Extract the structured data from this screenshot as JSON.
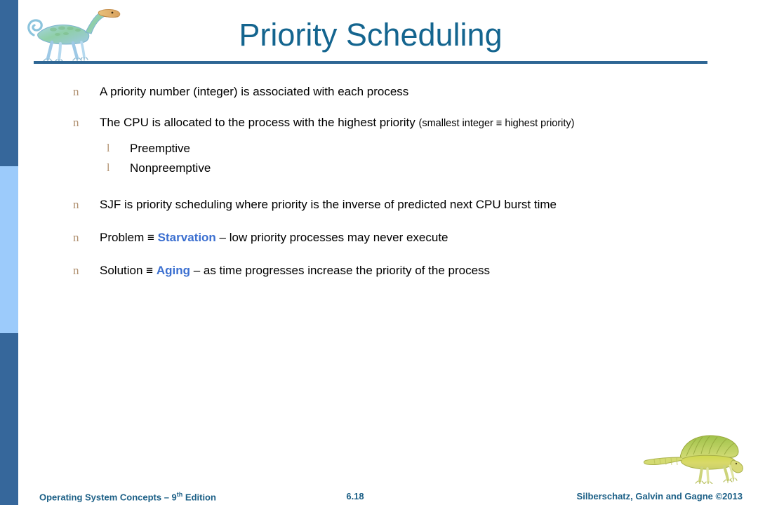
{
  "slide": {
    "title": "Priority Scheduling",
    "accent_color": "#14658f",
    "rule_color": "#2e6694",
    "bullet_marker_color": "#b09070",
    "keyword_color": "#3b6fd0",
    "sidebar_dark_color": "#36679b",
    "sidebar_light_color": "#9ccbfb"
  },
  "bullets": {
    "b1": {
      "marker": "n",
      "text": "A priority number (integer) is associated with each process"
    },
    "b2": {
      "marker": "n",
      "text_main": "The CPU is allocated to the process with the highest priority ",
      "text_small": "(smallest integer ≡ highest priority)"
    },
    "sub1": {
      "marker": "l",
      "text": "Preemptive"
    },
    "sub2": {
      "marker": "l",
      "text": "Nonpreemptive"
    },
    "b3": {
      "marker": "n",
      "text": "SJF is priority scheduling where priority is the inverse of predicted next CPU burst time"
    },
    "b4": {
      "marker": "n",
      "text_before": "Problem ≡ ",
      "keyword": "Starvation",
      "text_after": " – low priority processes may never execute"
    },
    "b5": {
      "marker": "n",
      "text_before": "Solution ≡ ",
      "keyword": "Aging",
      "text_after": " – as time progresses increase the priority of the process"
    }
  },
  "footer": {
    "book_prefix": "Operating System Concepts – 9",
    "book_sup": "th",
    "book_suffix": " Edition",
    "page_number": "6.18",
    "credit": "Silberschatz, Galvin and Gagne ©2013"
  },
  "icons": {
    "dino_top": "dinosaur-illustration",
    "dino_bottom": "sail-backed-dinosaur-illustration"
  }
}
